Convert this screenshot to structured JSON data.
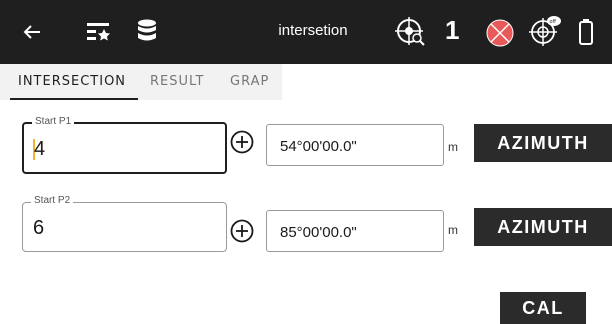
{
  "appbar": {
    "title": "intersetion",
    "count": "1",
    "icons": [
      "back-arrow-icon",
      "list-star-icon",
      "database-icon",
      "target-search-icon",
      "red-target-icon",
      "crosshair-off-icon",
      "battery-icon"
    ],
    "colors": {
      "bar": "#1f1f1f",
      "target_red": "#e85a5a"
    }
  },
  "tabs": [
    {
      "label": "INTERSECTION",
      "active": true
    },
    {
      "label": "RESULT",
      "active": false
    },
    {
      "label": "GRAP",
      "active": false
    }
  ],
  "form": {
    "p1": {
      "label": "Start P1",
      "value": "4",
      "angle": "54°00'00.0\"",
      "unit": "m",
      "button": "AZIMUTH"
    },
    "p2": {
      "label": "Start P2",
      "value": "6",
      "angle": "85°00'00.0\"",
      "unit": "m",
      "button": "AZIMUTH"
    },
    "cal": "CAL"
  }
}
